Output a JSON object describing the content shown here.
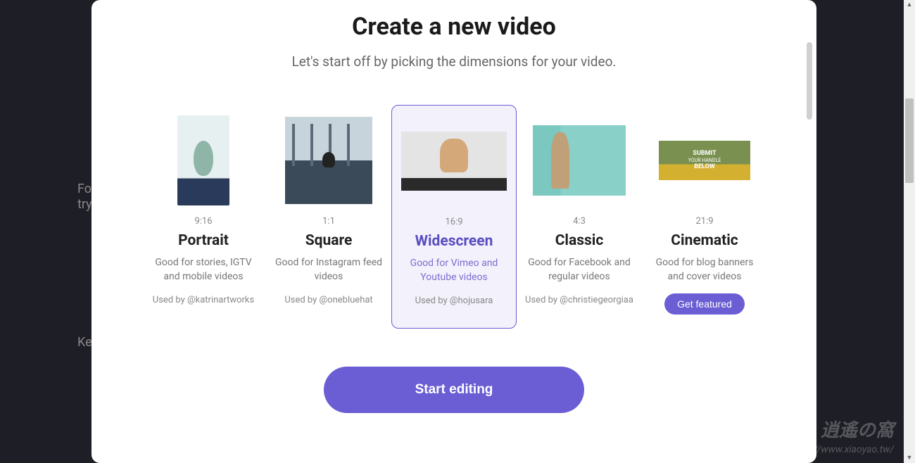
{
  "modal": {
    "title": "Create a new video",
    "subtitle": "Let's start off by picking the dimensions for your video.",
    "start_button": "Start editing",
    "get_featured": "Get featured"
  },
  "options": [
    {
      "id": "portrait",
      "ratio": "9:16",
      "name": "Portrait",
      "description": "Good for stories, IGTV and mobile videos",
      "used_by": "Used by @katrinartworks",
      "selected": false
    },
    {
      "id": "square",
      "ratio": "1:1",
      "name": "Square",
      "description": "Good for Instagram feed videos",
      "used_by": "Used by @onebluehat",
      "selected": false
    },
    {
      "id": "widescreen",
      "ratio": "16:9",
      "name": "Widescreen",
      "description": "Good for Vimeo and Youtube videos",
      "used_by": "Used by @hojusara",
      "selected": true
    },
    {
      "id": "classic",
      "ratio": "4:3",
      "name": "Classic",
      "description": "Good for Facebook and regular videos",
      "used_by": "Used by @christiegeorgiaa",
      "selected": false
    },
    {
      "id": "cinematic",
      "ratio": "21:9",
      "name": "Cinematic",
      "description": "Good for blog banners and cover videos",
      "used_by": null,
      "selected": false,
      "thumb_text_1": "SUBMIT",
      "thumb_text_2": "YOUR HANDLE",
      "thumb_text_3": "BELOW"
    }
  ],
  "background": {
    "line1": "Fo",
    "line2": "try",
    "line3": "Ke"
  },
  "watermark": {
    "title": "逍遙の窩",
    "url": "http://www.xiaoyao.tw/"
  },
  "colors": {
    "accent": "#6b5dd3",
    "bg": "#1e1e26"
  }
}
